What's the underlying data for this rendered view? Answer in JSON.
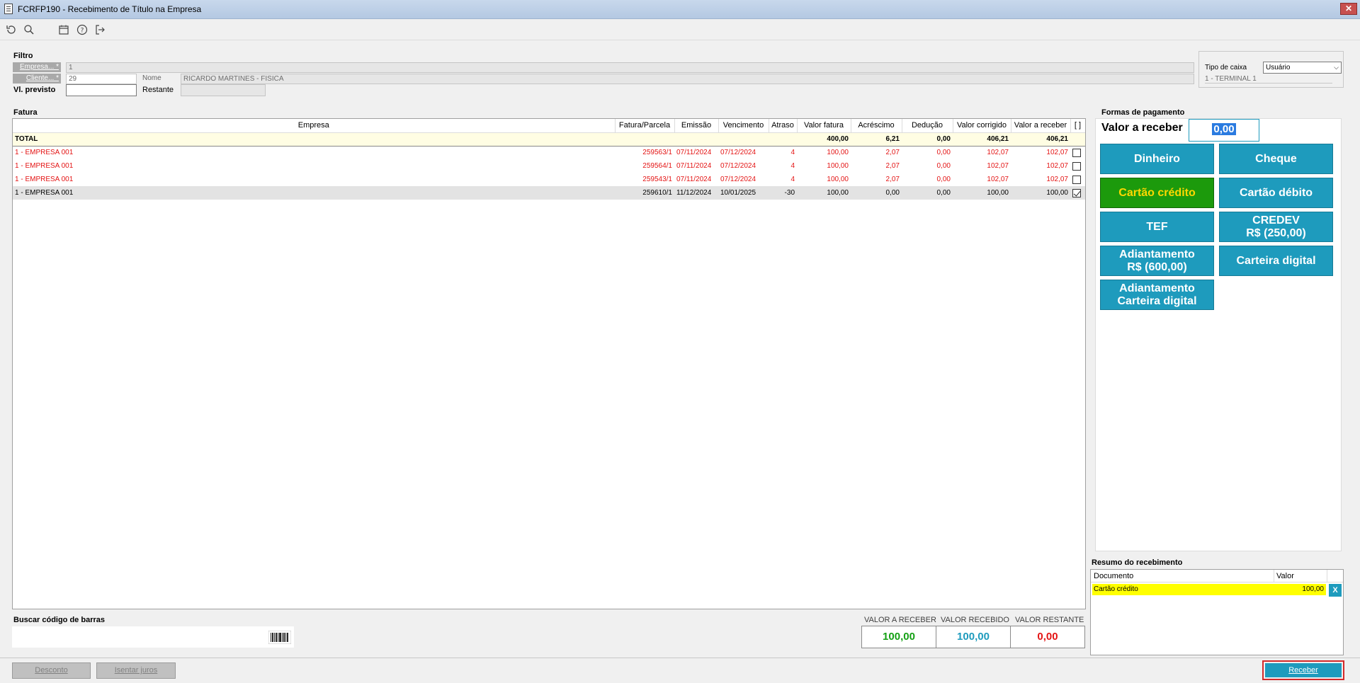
{
  "window": {
    "title": "FCRFP190 - Recebimento de Título na Empresa",
    "close_label": "✕"
  },
  "toolbar": {
    "icons": [
      "refresh-icon",
      "search-icon",
      "calendar-icon",
      "help-icon",
      "exit-icon"
    ]
  },
  "filtro": {
    "title": "Filtro",
    "empresa_label": "Empresa... *",
    "empresa_value": "1",
    "cliente_label": "Cliente... *",
    "cliente_value": "29",
    "nome_label": "Nome",
    "nome_value": "RICARDO MARTINES - FISICA",
    "vl_previsto_label": "Vl. previsto",
    "vl_previsto_value": "",
    "restante_label": "Restante",
    "restante_value": "",
    "tipo_caixa_label": "Tipo de caixa",
    "tipo_caixa_value": "Usuário",
    "terminal_value": "1 - TERMINAL 1"
  },
  "fatura": {
    "title": "Fatura",
    "columns": [
      "Empresa",
      "Fatura/Parcela",
      "Emissão",
      "Vencimento",
      "Atraso",
      "Valor fatura",
      "Acréscimo",
      "Dedução",
      "Valor corrigido",
      "Valor a receber",
      "[ ]"
    ],
    "total": {
      "label": "TOTAL",
      "valor_fatura": "400,00",
      "acrescimo": "6,21",
      "deducao": "0,00",
      "valor_corrigido": "406,21",
      "valor_receber": "406,21"
    },
    "rows": [
      {
        "empresa": "1 - EMPRESA 001",
        "fatura": "259563/1",
        "emissao": "07/11/2024",
        "vencimento": "07/12/2024",
        "atraso": "4",
        "valor_fatura": "100,00",
        "acrescimo": "2,07",
        "deducao": "0,00",
        "valor_corrigido": "102,07",
        "valor_receber": "102,07",
        "checked": false
      },
      {
        "empresa": "1 - EMPRESA 001",
        "fatura": "259564/1",
        "emissao": "07/11/2024",
        "vencimento": "07/12/2024",
        "atraso": "4",
        "valor_fatura": "100,00",
        "acrescimo": "2,07",
        "deducao": "0,00",
        "valor_corrigido": "102,07",
        "valor_receber": "102,07",
        "checked": false
      },
      {
        "empresa": "1 - EMPRESA 001",
        "fatura": "259543/1",
        "emissao": "07/11/2024",
        "vencimento": "07/12/2024",
        "atraso": "4",
        "valor_fatura": "100,00",
        "acrescimo": "2,07",
        "deducao": "0,00",
        "valor_corrigido": "102,07",
        "valor_receber": "102,07",
        "checked": false
      },
      {
        "empresa": "1 - EMPRESA 001",
        "fatura": "259610/1",
        "emissao": "11/12/2024",
        "vencimento": "10/01/2025",
        "atraso": "-30",
        "valor_fatura": "100,00",
        "acrescimo": "0,00",
        "deducao": "0,00",
        "valor_corrigido": "100,00",
        "valor_receber": "100,00",
        "checked": true
      }
    ]
  },
  "pagamento": {
    "title": "Formas de pagamento",
    "valor_receber_label": "Valor a receber",
    "valor_receber_value": "0,00",
    "buttons": [
      {
        "name": "dinheiro-button",
        "line1": "Dinheiro",
        "line2": ""
      },
      {
        "name": "cheque-button",
        "line1": "Cheque",
        "line2": ""
      },
      {
        "name": "cartao-credito-button",
        "line1": "Cartão crédito",
        "line2": ""
      },
      {
        "name": "cartao-debito-button",
        "line1": "Cartão débito",
        "line2": ""
      },
      {
        "name": "tef-button",
        "line1": "TEF",
        "line2": ""
      },
      {
        "name": "credev-button",
        "line1": "CREDEV",
        "line2": "R$ (250,00)"
      },
      {
        "name": "adiantamento-button",
        "line1": "Adiantamento",
        "line2": "R$ (600,00)"
      },
      {
        "name": "carteira-digital-button",
        "line1": "Carteira digital",
        "line2": ""
      },
      {
        "name": "adiantamento-carteira-button",
        "line1": "Adiantamento",
        "line2": "Carteira digital"
      }
    ]
  },
  "resumo": {
    "title": "Resumo do recebimento",
    "col_documento": "Documento",
    "col_valor": "Valor",
    "rows": [
      {
        "documento": "Cartão crédito",
        "valor": "100,00",
        "remove_label": "X"
      }
    ]
  },
  "barcode": {
    "label": "Buscar código de barras",
    "value": ""
  },
  "totals": {
    "receber_label": "VALOR A RECEBER",
    "receber_value": "100,00",
    "recebido_label": "VALOR RECEBIDO",
    "recebido_value": "100,00",
    "restante_label": "VALOR RESTANTE",
    "restante_value": "0,00"
  },
  "actions": {
    "desconto": "Desconto",
    "isentar_juros": "Isentar juros",
    "receber": "Receber"
  },
  "colors": {
    "accent": "#1e9bbd",
    "active_green": "#1c9a0c",
    "overdue_red": "#e41414",
    "receber_green": "#14a014",
    "recebido_blue": "#1e9bbd",
    "restante_red": "#e41414"
  }
}
